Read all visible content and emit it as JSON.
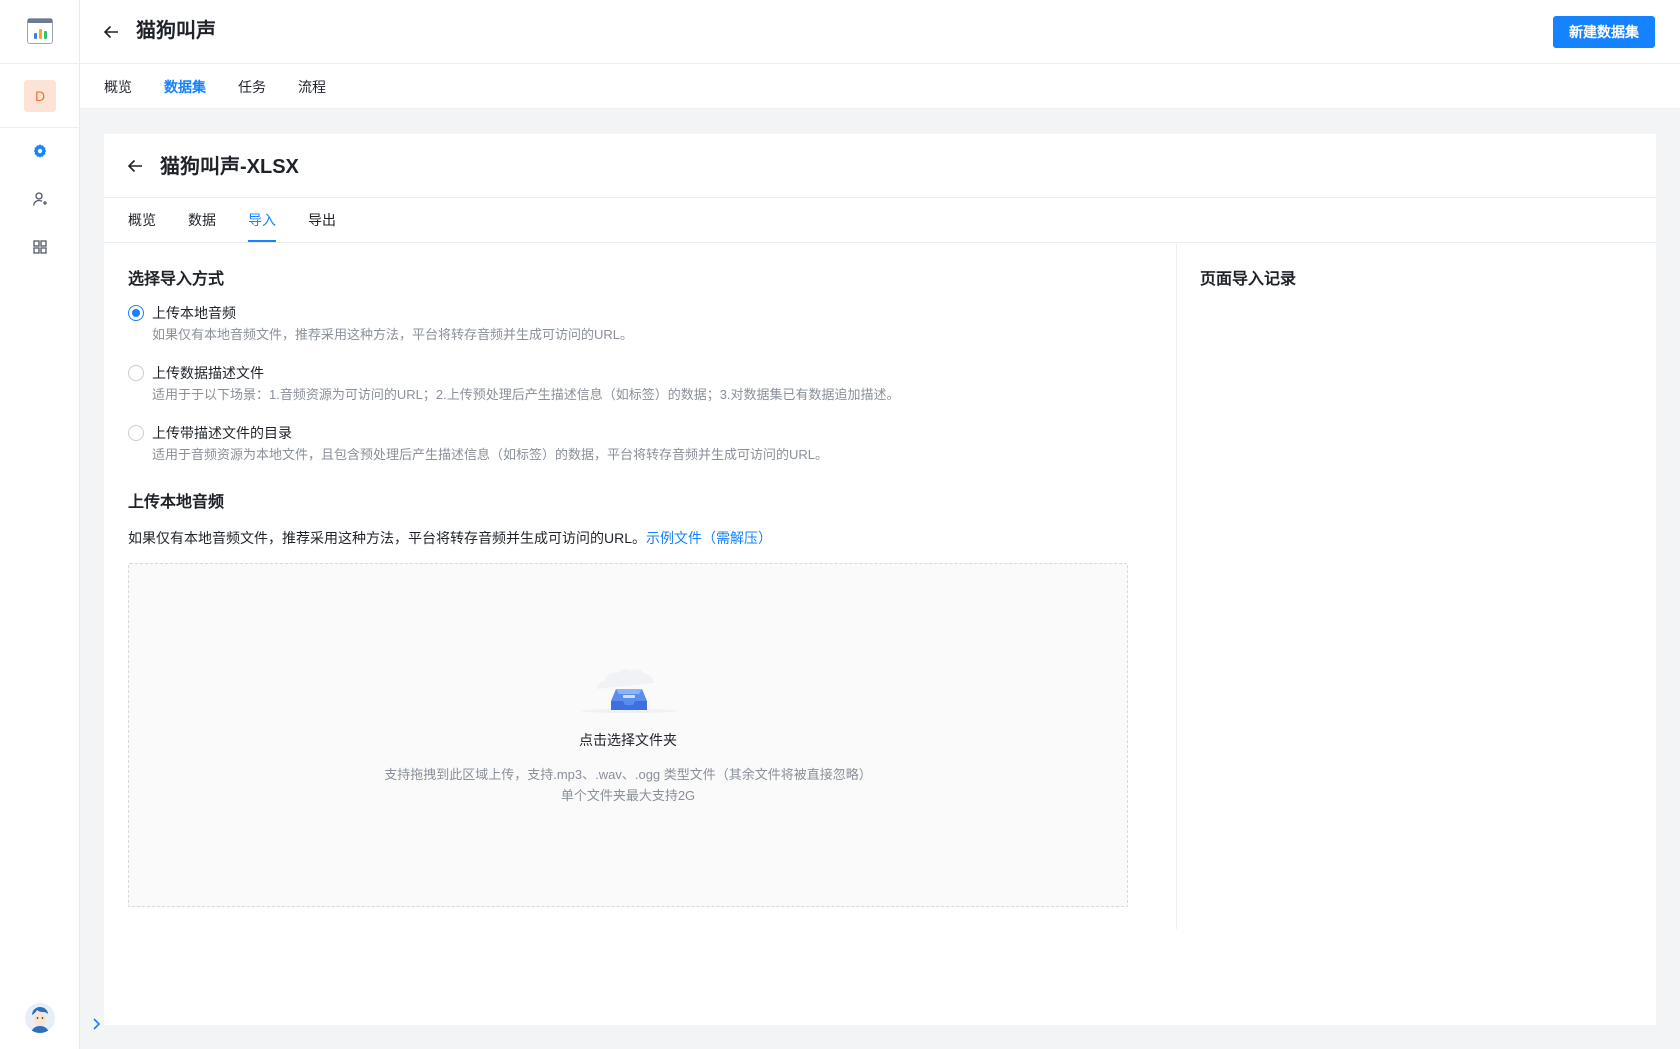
{
  "header": {
    "title": "猫狗叫声",
    "new_button_label": "新建数据集"
  },
  "sidebar": {
    "workspace_initial": "D",
    "icons": [
      "settings-icon",
      "user-management-icon",
      "apps-grid-icon"
    ]
  },
  "top_tabs": [
    {
      "label": "概览",
      "active": false
    },
    {
      "label": "数据集",
      "active": true
    },
    {
      "label": "任务",
      "active": false
    },
    {
      "label": "流程",
      "active": false
    }
  ],
  "dataset": {
    "title": "猫狗叫声-XLSX",
    "tabs": [
      {
        "label": "概览",
        "active": false
      },
      {
        "label": "数据",
        "active": false
      },
      {
        "label": "导入",
        "active": true
      },
      {
        "label": "导出",
        "active": false
      }
    ]
  },
  "import": {
    "choose_title": "选择导入方式",
    "options": [
      {
        "label": "上传本地音频",
        "desc": "如果仅有本地音频文件，推荐采用这种方法，平台将转存音频并生成可访问的URL。",
        "checked": true
      },
      {
        "label": "上传数据描述文件",
        "desc": "适用于于以下场景：1.音频资源为可访问的URL；2.上传预处理后产生描述信息（如标签）的数据；3.对数据集已有数据追加描述。",
        "checked": false
      },
      {
        "label": "上传带描述文件的目录",
        "desc": "适用于音频资源为本地文件，且包含预处理后产生描述信息（如标签）的数据，平台将转存音频并生成可访问的URL。",
        "checked": false
      }
    ],
    "upload_title": "上传本地音频",
    "upload_desc": "如果仅有本地音频文件，推荐采用这种方法，平台将转存音频并生成可访问的URL。",
    "sample_link": "示例文件（需解压）",
    "dropzone": {
      "title": "点击选择文件夹",
      "hint_line1": "支持拖拽到此区域上传，支持.mp3、.wav、.ogg 类型文件（其余文件将被直接忽略）",
      "hint_line2": "单个文件夹最大支持2G"
    }
  },
  "records": {
    "title": "页面导入记录"
  }
}
